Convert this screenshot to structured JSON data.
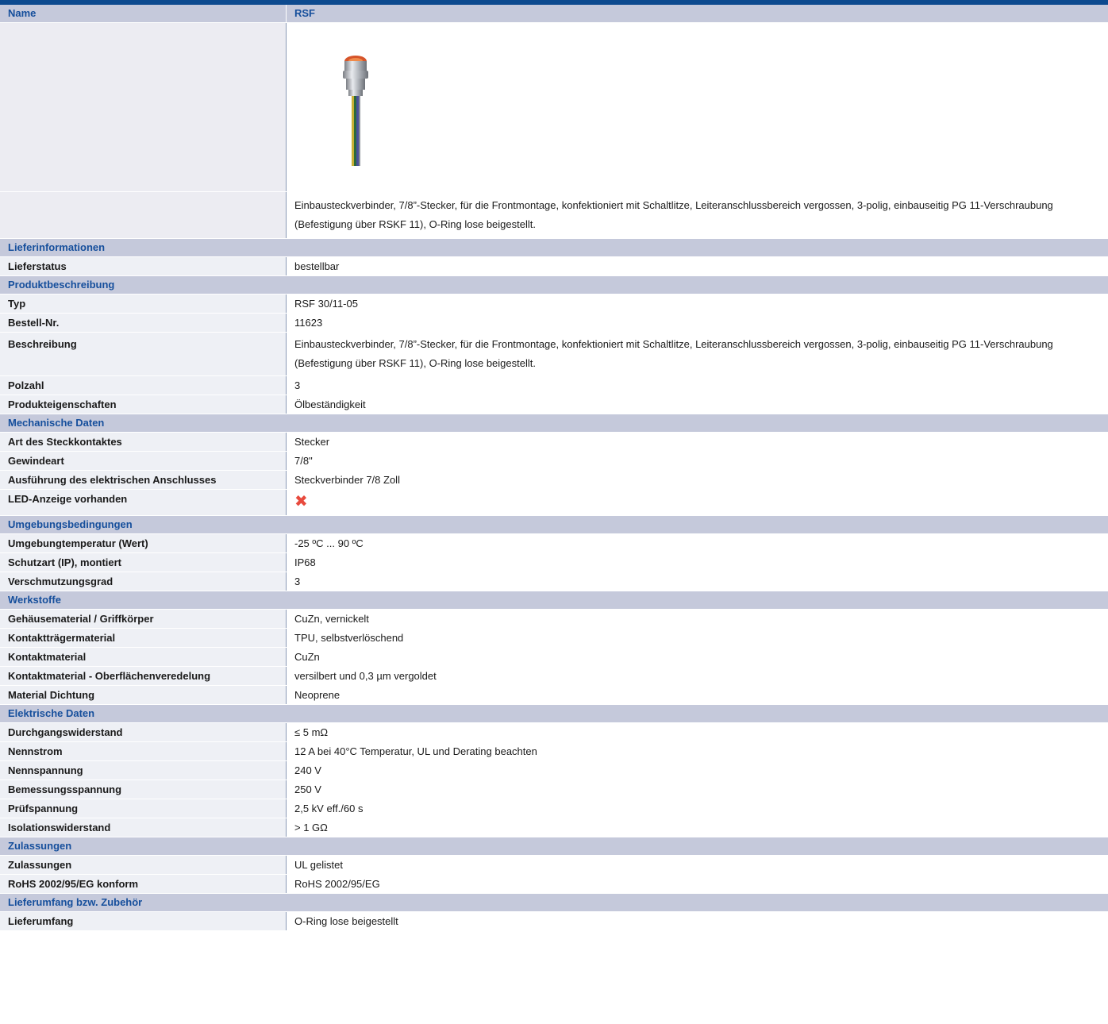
{
  "header": {
    "name_label": "Name",
    "name_value": "RSF"
  },
  "description_text": "Einbausteckverbinder, 7/8”-Stecker, für die Frontmontage, konfektioniert mit Schaltlitze, Leiteranschlussbereich vergossen, 3-polig, einbauseitig PG 11-Verschraubung (Befestigung über RSKF 11), O-Ring lose beigestellt.",
  "sections": [
    {
      "title": "Lieferinformationen",
      "rows": [
        {
          "label": "Lieferstatus",
          "value": "bestellbar"
        }
      ]
    },
    {
      "title": "Produktbeschreibung",
      "rows": [
        {
          "label": "Typ",
          "value": "RSF 30/11-05"
        },
        {
          "label": "Bestell-Nr.",
          "value": "11623"
        },
        {
          "label": "Beschreibung",
          "value": "Einbausteckverbinder, 7/8”-Stecker, für die Frontmontage, konfektioniert mit Schaltlitze, Leiteranschlussbereich vergossen, 3-polig, einbauseitig PG 11-Verschraubung (Befestigung über RSKF 11), O-Ring lose beigestellt."
        },
        {
          "label": "Polzahl",
          "value": "3"
        },
        {
          "label": "Produkteigenschaften",
          "value": "Ölbeständigkeit"
        }
      ]
    },
    {
      "title": "Mechanische Daten",
      "rows": [
        {
          "label": "Art des Steckkontaktes",
          "value": "Stecker"
        },
        {
          "label": "Gewindeart",
          "value": "7/8\""
        },
        {
          "label": "Ausführung des elektrischen Anschlusses",
          "value": "Steckverbinder 7/8 Zoll"
        },
        {
          "label": "LED-Anzeige vorhanden",
          "value": "✖"
        }
      ]
    },
    {
      "title": "Umgebungsbedingungen",
      "rows": [
        {
          "label": "Umgebungtemperatur (Wert)",
          "value": "-25 ºC ... 90 ºC"
        },
        {
          "label": "Schutzart (IP), montiert",
          "value": "IP68"
        },
        {
          "label": "Verschmutzungsgrad",
          "value": "3"
        }
      ]
    },
    {
      "title": "Werkstoffe",
      "rows": [
        {
          "label": "Gehäusematerial / Griffkörper",
          "value": "CuZn, vernickelt"
        },
        {
          "label": "Kontaktträgermaterial",
          "value": "TPU, selbstverlöschend"
        },
        {
          "label": "Kontaktmaterial",
          "value": "CuZn"
        },
        {
          "label": "Kontaktmaterial - Oberflächenveredelung",
          "value": "versilbert und 0,3 µm vergoldet"
        },
        {
          "label": "Material Dichtung",
          "value": "Neoprene"
        }
      ]
    },
    {
      "title": "Elektrische Daten",
      "rows": [
        {
          "label": "Durchgangswiderstand",
          "value": "≤ 5 mΩ"
        },
        {
          "label": "Nennstrom",
          "value": "12 A bei 40°C Temperatur, UL und Derating beachten"
        },
        {
          "label": "Nennspannung",
          "value": "240 V"
        },
        {
          "label": "Bemessungsspannung",
          "value": "250 V"
        },
        {
          "label": "Prüfspannung",
          "value": "2,5 kV eff./60 s"
        },
        {
          "label": "Isolationswiderstand",
          "value": "> 1 GΩ"
        }
      ]
    },
    {
      "title": "Zulassungen",
      "rows": [
        {
          "label": "Zulassungen",
          "value": "UL gelistet"
        },
        {
          "label": "RoHS 2002/95/EG konform",
          "value": "RoHS 2002/95/EG"
        }
      ]
    },
    {
      "title": "Lieferumfang bzw. Zubehör",
      "rows": [
        {
          "label": "Lieferumfang",
          "value": "O-Ring lose beigestellt"
        }
      ]
    }
  ]
}
